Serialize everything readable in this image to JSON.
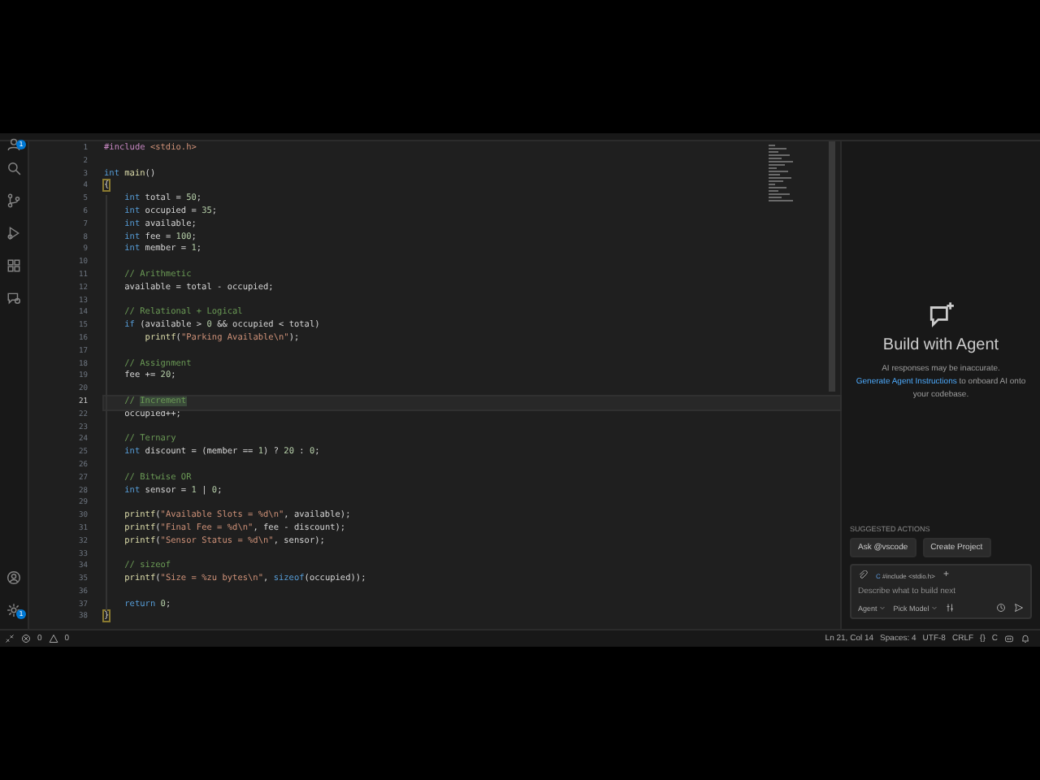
{
  "activity_bar": {
    "accounts_badge": "1",
    "settings_badge": "1"
  },
  "editor": {
    "lines": [
      {
        "number": "1",
        "selected": false,
        "tokens": [
          {
            "kind": "pp",
            "text": "#include "
          },
          {
            "kind": "str",
            "text": "<stdio.h>"
          }
        ]
      },
      {
        "number": "2",
        "selected": false
      },
      {
        "number": "3",
        "selected": false,
        "tokens": [
          {
            "kind": "kw",
            "text": "int"
          },
          {
            "kind": "fn",
            "text": " main"
          },
          {
            "kind": "plain",
            "text": "()"
          }
        ]
      },
      {
        "number": "4",
        "selected": false,
        "tokens": [
          {
            "kind": "brace",
            "text": "{"
          }
        ]
      },
      {
        "number": "5",
        "selected": false,
        "tokens": [
          {
            "kind": "kw",
            "text": "    int"
          },
          {
            "kind": "plain",
            "text": " total = "
          },
          {
            "kind": "num",
            "text": "50"
          },
          {
            "kind": "plain",
            "text": ";"
          }
        ]
      },
      {
        "number": "6",
        "selected": false,
        "tokens": [
          {
            "kind": "kw",
            "text": "    int"
          },
          {
            "kind": "plain",
            "text": " occupied = "
          },
          {
            "kind": "num",
            "text": "35"
          },
          {
            "kind": "plain",
            "text": ";"
          }
        ]
      },
      {
        "number": "7",
        "selected": false,
        "tokens": [
          {
            "kind": "kw",
            "text": "    int"
          },
          {
            "kind": "plain",
            "text": " available;"
          }
        ]
      },
      {
        "number": "8",
        "selected": false,
        "tokens": [
          {
            "kind": "kw",
            "text": "    int"
          },
          {
            "kind": "plain",
            "text": " fee = "
          },
          {
            "kind": "num",
            "text": "100"
          },
          {
            "kind": "plain",
            "text": ";"
          }
        ]
      },
      {
        "number": "9",
        "selected": false,
        "tokens": [
          {
            "kind": "kw",
            "text": "    int"
          },
          {
            "kind": "plain",
            "text": " member = "
          },
          {
            "kind": "num",
            "text": "1"
          },
          {
            "kind": "plain",
            "text": ";"
          }
        ]
      },
      {
        "number": "10",
        "selected": false
      },
      {
        "number": "11",
        "selected": false,
        "tokens": [
          {
            "kind": "cmt",
            "text": "    // Arithmetic"
          }
        ]
      },
      {
        "number": "12",
        "selected": false,
        "tokens": [
          {
            "kind": "plain",
            "text": "    available = total - occupied;"
          }
        ]
      },
      {
        "number": "13",
        "selected": false
      },
      {
        "number": "14",
        "selected": false,
        "tokens": [
          {
            "kind": "cmt",
            "text": "    // Relational + Logical"
          }
        ]
      },
      {
        "number": "15",
        "selected": false,
        "tokens": [
          {
            "kind": "kw",
            "text": "    if"
          },
          {
            "kind": "plain",
            "text": " (available > "
          },
          {
            "kind": "num",
            "text": "0"
          },
          {
            "kind": "plain",
            "text": " && occupied < total)"
          }
        ]
      },
      {
        "number": "16",
        "selected": false,
        "tokens": [
          {
            "kind": "fn",
            "text": "        printf"
          },
          {
            "kind": "plain",
            "text": "("
          },
          {
            "kind": "str",
            "text": "\"Parking Available\\n\""
          },
          {
            "kind": "plain",
            "text": ");"
          }
        ]
      },
      {
        "number": "17",
        "selected": false
      },
      {
        "number": "18",
        "selected": false,
        "tokens": [
          {
            "kind": "cmt",
            "text": "    // Assignment"
          }
        ]
      },
      {
        "number": "19",
        "selected": false,
        "tokens": [
          {
            "kind": "plain",
            "text": "    fee += "
          },
          {
            "kind": "num",
            "text": "20"
          },
          {
            "kind": "plain",
            "text": ";"
          }
        ]
      },
      {
        "number": "20",
        "selected": false
      },
      {
        "number": "21",
        "selected": true,
        "tokens": [
          {
            "kind": "cmt",
            "text": "    // "
          },
          {
            "kind": "sel",
            "text": "Increment"
          }
        ]
      },
      {
        "number": "22",
        "selected": false,
        "tokens": [
          {
            "kind": "plain",
            "text": "    occupied++;"
          }
        ]
      },
      {
        "number": "23",
        "selected": false
      },
      {
        "number": "24",
        "selected": false,
        "tokens": [
          {
            "kind": "cmt",
            "text": "    // Ternary"
          }
        ]
      },
      {
        "number": "25",
        "selected": false,
        "tokens": [
          {
            "kind": "kw",
            "text": "    int"
          },
          {
            "kind": "plain",
            "text": " discount = (member == "
          },
          {
            "kind": "num",
            "text": "1"
          },
          {
            "kind": "plain",
            "text": ") ? "
          },
          {
            "kind": "num",
            "text": "20"
          },
          {
            "kind": "plain",
            "text": " : "
          },
          {
            "kind": "num",
            "text": "0"
          },
          {
            "kind": "plain",
            "text": ";"
          }
        ]
      },
      {
        "number": "26",
        "selected": false
      },
      {
        "number": "27",
        "selected": false,
        "tokens": [
          {
            "kind": "cmt",
            "text": "    // Bitwise OR"
          }
        ]
      },
      {
        "number": "28",
        "selected": false,
        "tokens": [
          {
            "kind": "kw",
            "text": "    int"
          },
          {
            "kind": "plain",
            "text": " sensor = "
          },
          {
            "kind": "num",
            "text": "1"
          },
          {
            "kind": "plain",
            "text": " | "
          },
          {
            "kind": "num",
            "text": "0"
          },
          {
            "kind": "plain",
            "text": ";"
          }
        ]
      },
      {
        "number": "29",
        "selected": false
      },
      {
        "number": "30",
        "selected": false,
        "tokens": [
          {
            "kind": "fn",
            "text": "    printf"
          },
          {
            "kind": "plain",
            "text": "("
          },
          {
            "kind": "str",
            "text": "\"Available Slots = %d\\n\""
          },
          {
            "kind": "plain",
            "text": ", available);"
          }
        ]
      },
      {
        "number": "31",
        "selected": false,
        "tokens": [
          {
            "kind": "fn",
            "text": "    printf"
          },
          {
            "kind": "plain",
            "text": "("
          },
          {
            "kind": "str",
            "text": "\"Final Fee = %d\\n\""
          },
          {
            "kind": "plain",
            "text": ", fee - discount);"
          }
        ]
      },
      {
        "number": "32",
        "selected": false,
        "tokens": [
          {
            "kind": "fn",
            "text": "    printf"
          },
          {
            "kind": "plain",
            "text": "("
          },
          {
            "kind": "str",
            "text": "\"Sensor Status = %d\\n\""
          },
          {
            "kind": "plain",
            "text": ", sensor);"
          }
        ]
      },
      {
        "number": "33",
        "selected": false
      },
      {
        "number": "34",
        "selected": false,
        "tokens": [
          {
            "kind": "cmt",
            "text": "    // sizeof"
          }
        ]
      },
      {
        "number": "35",
        "selected": false,
        "tokens": [
          {
            "kind": "fn",
            "text": "    printf"
          },
          {
            "kind": "plain",
            "text": "("
          },
          {
            "kind": "str",
            "text": "\"Size = %zu bytes\\n\""
          },
          {
            "kind": "plain",
            "text": ", "
          },
          {
            "kind": "kw",
            "text": "sizeof"
          },
          {
            "kind": "plain",
            "text": "(occupied));"
          }
        ]
      },
      {
        "number": "36",
        "selected": false
      },
      {
        "number": "37",
        "selected": false,
        "tokens": [
          {
            "kind": "kw",
            "text": "    return"
          },
          {
            "kind": "num",
            "text": " 0"
          },
          {
            "kind": "plain",
            "text": ";"
          }
        ]
      },
      {
        "number": "38",
        "selected": false,
        "tokens": [
          {
            "kind": "brace",
            "text": "}"
          }
        ]
      }
    ]
  },
  "chat": {
    "title": "Build with Agent",
    "disclaimer": "AI responses may be inaccurate.",
    "link": "Generate Agent Instructions",
    "link_suffix": " to onboard AI onto your codebase.",
    "suggested_label": "SUGGESTED ACTIONS",
    "actions": [
      "Ask @vscode",
      "Create Project"
    ],
    "input": {
      "context_file_icon": "C",
      "context_file": "#include <stdio.h>",
      "add": "+",
      "placeholder": "Describe what to build next",
      "mode": "Agent",
      "model": "Pick Model"
    }
  },
  "status_bar": {
    "errors": "0",
    "warnings": "0",
    "position": "Ln 21, Col 14",
    "indent": "Spaces: 4",
    "encoding": "UTF-8",
    "eol": "CRLF",
    "language_icon": "{}",
    "language": "C"
  }
}
